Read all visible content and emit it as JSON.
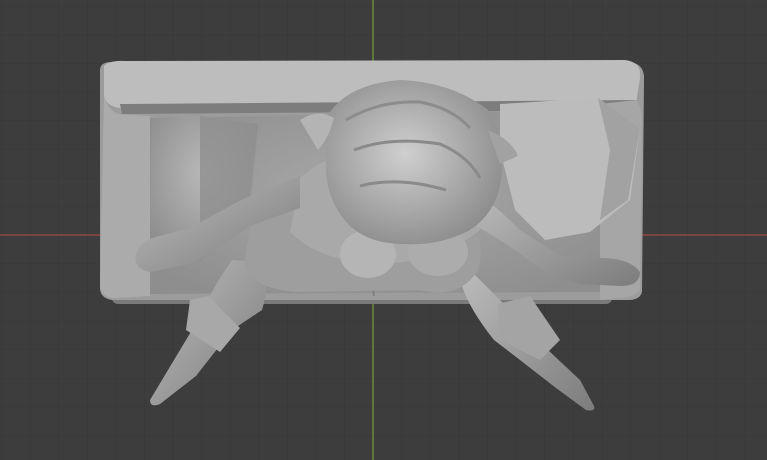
{
  "viewport": {
    "background": "#3d3d3d",
    "grid_minor_color": "#363636",
    "grid_major_color": "#2f2f2f",
    "axis_x_color": "#c04a4a",
    "axis_y_color": "#7fb33a",
    "model_base_color": "#9a9a9a",
    "model_light_color": "#c4c4c4",
    "model_shadow_color": "#6e6e6e"
  },
  "scene": {
    "objects": [
      {
        "name": "sofa",
        "icon": "sofa-model"
      },
      {
        "name": "figure",
        "icon": "character-sculpt"
      }
    ]
  }
}
